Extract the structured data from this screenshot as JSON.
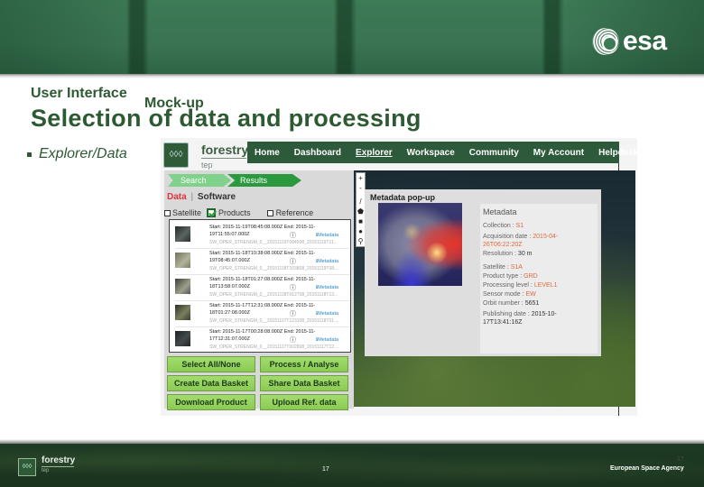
{
  "slide": {
    "title_prefix": "User Interface",
    "title_suffix": "Mock-up",
    "heading": "Selection of data and processing",
    "bullet": "Explorer/Data",
    "logo_text": "esa",
    "page_number": "17",
    "page_number_right": "17",
    "footer_agency": "European Space Agency",
    "footer_logo_name": "forestry",
    "footer_logo_sub": "tep"
  },
  "app": {
    "logo_name": "forestry",
    "logo_sub": "tep",
    "nav": [
      {
        "label": "Home",
        "active": false
      },
      {
        "label": "Dashboard",
        "active": false
      },
      {
        "label": "Explorer",
        "active": true
      },
      {
        "label": "Workspace",
        "active": false
      },
      {
        "label": "Community",
        "active": false
      },
      {
        "label": "My Account",
        "active": false
      },
      {
        "label": "Helpdesk",
        "active": false
      }
    ],
    "steps": [
      "Search",
      "Results"
    ],
    "tabs": {
      "data": "Data",
      "separator": "|",
      "software": "Software"
    },
    "filters": [
      {
        "label": "Satellite",
        "checked": false
      },
      {
        "label": "Products",
        "checked": true
      },
      {
        "label": "Reference",
        "checked": false
      }
    ],
    "results": [
      {
        "line1": "Start: 2015-11-19T08:45:08.000Z End: 2015-11-",
        "line2": "19T11:55:07.000Z",
        "id": "SW_OPER_STRENGM_0__20151119T084508_20151119T11...",
        "metadata": "Metadata"
      },
      {
        "line1": "Start: 2015-11-18T10:38:08.000Z End: 2015-11-",
        "line2": "19T08:45:07.000Z",
        "id": "SW_OPER_STRENGM_0__20151118T103808_20151119T08...",
        "metadata": "Metadata"
      },
      {
        "line1": "Start: 2015-11-18T01:27:08.000Z End: 2015-11-",
        "line2": "18T13:58:07.000Z",
        "id": "SW_OPER_STRENGM_0__20151118T012708_20151118T13...",
        "metadata": "Metadata"
      },
      {
        "line1": "Start: 2015-11-17T12:31:08.000Z End: 2015-11-",
        "line2": "18T01:27:08.000Z",
        "id": "SW_OPER_STRENGM_0__20151117T123108_20151118T01...",
        "metadata": "Metadata"
      },
      {
        "line1": "Start: 2015-11-17T00:28:08.000Z End: 2015-11-",
        "line2": "17T12:31:07.000Z",
        "id": "SW_OPER_STRENGM_0__20151117T002808_20151117T12...",
        "metadata": "Metadata"
      }
    ],
    "buttons": [
      "Select All/None",
      "Process / Analyse",
      "Create Data Basket",
      "Share Data Basket",
      "Download Product",
      "Upload Ref. data"
    ],
    "map_tools": [
      "+",
      "-",
      "/",
      "⬟",
      "■",
      "●",
      "⚲"
    ],
    "popup": {
      "title": "Metadata pop-up",
      "heading": "Metadata",
      "fields": [
        {
          "label": "Collection :",
          "value": "S1"
        },
        {
          "label": "Acquisition date :",
          "value": "2015-04-26T06:22:20Z"
        },
        {
          "label": "Resolution :",
          "value": "30 m"
        },
        {
          "label": "Satellite :",
          "value": "S1A"
        },
        {
          "label": "Product type :",
          "value": "GRD"
        },
        {
          "label": "Processing level :",
          "value": "LEVEL1"
        },
        {
          "label": "Sensor mode :",
          "value": "EW"
        },
        {
          "label": "Orbit number :",
          "value": "5651"
        },
        {
          "label": "Publishing date :",
          "value": "2015-10-17T13:41:16Z"
        }
      ]
    }
  },
  "colors": {
    "brand_green": "#2d5a32",
    "nav_green": "#2d5a3a",
    "button_green": "#8acb52",
    "accent_red": "#e0343a",
    "meta_orange": "#e06a3c",
    "link_blue": "#2a86c7"
  }
}
